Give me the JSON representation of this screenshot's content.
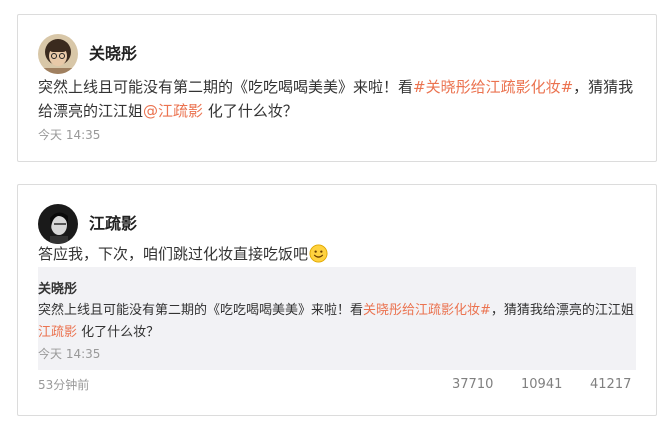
{
  "post1": {
    "username": "关晓彤",
    "text_before": "突然上线且可能没有第二期的《吃吃喝喝美美》来啦！看",
    "hashtag": "#关晓彤给江疏影化妆#",
    "text_middle": "，猜猜我给漂亮的江江姐",
    "mention": "@江疏影",
    "text_after": " 化了什么妆？",
    "timestamp": "今天 14:35"
  },
  "post2": {
    "username": "江疏影",
    "text": "答应我，下次，咱们跳过化妆直接吃饭吧",
    "emoji_icon": "smiley-icon",
    "repost": {
      "username": "关晓彤",
      "text_before": "突然上线且可能没有第二期的《吃吃喝喝美美》来啦！看",
      "hashtag": "关晓彤给江疏影化妆#",
      "text_middle": "，猜猜我给漂亮的江江姐",
      "mention": "江疏影",
      "text_after": " 化了什么妆？",
      "timestamp": "今天 14:35"
    },
    "timestamp": "53分钟前",
    "stats": {
      "reposts": "37710",
      "comments": "10941",
      "likes": "41217"
    }
  },
  "colors": {
    "link": "#eb7350",
    "timestamp": "#999999",
    "repost_bg": "#f2f2f5",
    "card_border": "#dcdcdc"
  }
}
